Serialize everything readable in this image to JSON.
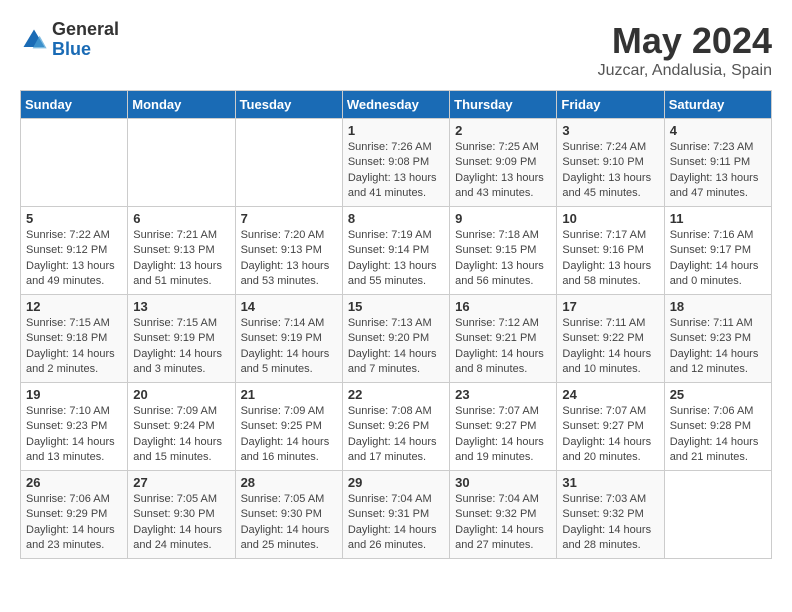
{
  "header": {
    "logo_general": "General",
    "logo_blue": "Blue",
    "month_year": "May 2024",
    "location": "Juzcar, Andalusia, Spain"
  },
  "days_of_week": [
    "Sunday",
    "Monday",
    "Tuesday",
    "Wednesday",
    "Thursday",
    "Friday",
    "Saturday"
  ],
  "weeks": [
    [
      {
        "day": "",
        "info": ""
      },
      {
        "day": "",
        "info": ""
      },
      {
        "day": "",
        "info": ""
      },
      {
        "day": "1",
        "info": "Sunrise: 7:26 AM\nSunset: 9:08 PM\nDaylight: 13 hours\nand 41 minutes."
      },
      {
        "day": "2",
        "info": "Sunrise: 7:25 AM\nSunset: 9:09 PM\nDaylight: 13 hours\nand 43 minutes."
      },
      {
        "day": "3",
        "info": "Sunrise: 7:24 AM\nSunset: 9:10 PM\nDaylight: 13 hours\nand 45 minutes."
      },
      {
        "day": "4",
        "info": "Sunrise: 7:23 AM\nSunset: 9:11 PM\nDaylight: 13 hours\nand 47 minutes."
      }
    ],
    [
      {
        "day": "5",
        "info": "Sunrise: 7:22 AM\nSunset: 9:12 PM\nDaylight: 13 hours\nand 49 minutes."
      },
      {
        "day": "6",
        "info": "Sunrise: 7:21 AM\nSunset: 9:13 PM\nDaylight: 13 hours\nand 51 minutes."
      },
      {
        "day": "7",
        "info": "Sunrise: 7:20 AM\nSunset: 9:13 PM\nDaylight: 13 hours\nand 53 minutes."
      },
      {
        "day": "8",
        "info": "Sunrise: 7:19 AM\nSunset: 9:14 PM\nDaylight: 13 hours\nand 55 minutes."
      },
      {
        "day": "9",
        "info": "Sunrise: 7:18 AM\nSunset: 9:15 PM\nDaylight: 13 hours\nand 56 minutes."
      },
      {
        "day": "10",
        "info": "Sunrise: 7:17 AM\nSunset: 9:16 PM\nDaylight: 13 hours\nand 58 minutes."
      },
      {
        "day": "11",
        "info": "Sunrise: 7:16 AM\nSunset: 9:17 PM\nDaylight: 14 hours\nand 0 minutes."
      }
    ],
    [
      {
        "day": "12",
        "info": "Sunrise: 7:15 AM\nSunset: 9:18 PM\nDaylight: 14 hours\nand 2 minutes."
      },
      {
        "day": "13",
        "info": "Sunrise: 7:15 AM\nSunset: 9:19 PM\nDaylight: 14 hours\nand 3 minutes."
      },
      {
        "day": "14",
        "info": "Sunrise: 7:14 AM\nSunset: 9:19 PM\nDaylight: 14 hours\nand 5 minutes."
      },
      {
        "day": "15",
        "info": "Sunrise: 7:13 AM\nSunset: 9:20 PM\nDaylight: 14 hours\nand 7 minutes."
      },
      {
        "day": "16",
        "info": "Sunrise: 7:12 AM\nSunset: 9:21 PM\nDaylight: 14 hours\nand 8 minutes."
      },
      {
        "day": "17",
        "info": "Sunrise: 7:11 AM\nSunset: 9:22 PM\nDaylight: 14 hours\nand 10 minutes."
      },
      {
        "day": "18",
        "info": "Sunrise: 7:11 AM\nSunset: 9:23 PM\nDaylight: 14 hours\nand 12 minutes."
      }
    ],
    [
      {
        "day": "19",
        "info": "Sunrise: 7:10 AM\nSunset: 9:23 PM\nDaylight: 14 hours\nand 13 minutes."
      },
      {
        "day": "20",
        "info": "Sunrise: 7:09 AM\nSunset: 9:24 PM\nDaylight: 14 hours\nand 15 minutes."
      },
      {
        "day": "21",
        "info": "Sunrise: 7:09 AM\nSunset: 9:25 PM\nDaylight: 14 hours\nand 16 minutes."
      },
      {
        "day": "22",
        "info": "Sunrise: 7:08 AM\nSunset: 9:26 PM\nDaylight: 14 hours\nand 17 minutes."
      },
      {
        "day": "23",
        "info": "Sunrise: 7:07 AM\nSunset: 9:27 PM\nDaylight: 14 hours\nand 19 minutes."
      },
      {
        "day": "24",
        "info": "Sunrise: 7:07 AM\nSunset: 9:27 PM\nDaylight: 14 hours\nand 20 minutes."
      },
      {
        "day": "25",
        "info": "Sunrise: 7:06 AM\nSunset: 9:28 PM\nDaylight: 14 hours\nand 21 minutes."
      }
    ],
    [
      {
        "day": "26",
        "info": "Sunrise: 7:06 AM\nSunset: 9:29 PM\nDaylight: 14 hours\nand 23 minutes."
      },
      {
        "day": "27",
        "info": "Sunrise: 7:05 AM\nSunset: 9:30 PM\nDaylight: 14 hours\nand 24 minutes."
      },
      {
        "day": "28",
        "info": "Sunrise: 7:05 AM\nSunset: 9:30 PM\nDaylight: 14 hours\nand 25 minutes."
      },
      {
        "day": "29",
        "info": "Sunrise: 7:04 AM\nSunset: 9:31 PM\nDaylight: 14 hours\nand 26 minutes."
      },
      {
        "day": "30",
        "info": "Sunrise: 7:04 AM\nSunset: 9:32 PM\nDaylight: 14 hours\nand 27 minutes."
      },
      {
        "day": "31",
        "info": "Sunrise: 7:03 AM\nSunset: 9:32 PM\nDaylight: 14 hours\nand 28 minutes."
      },
      {
        "day": "",
        "info": ""
      }
    ]
  ]
}
